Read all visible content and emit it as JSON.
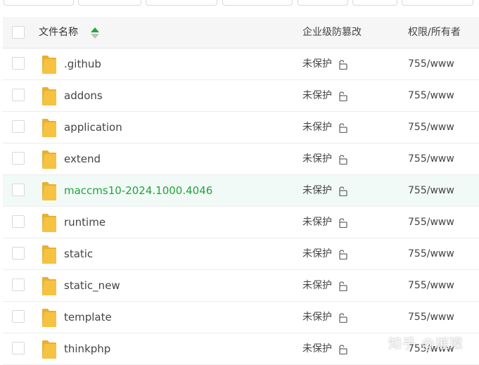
{
  "table": {
    "headers": {
      "name": "文件名称",
      "protection": "企业级防篡改",
      "permission": "权限/所有者"
    },
    "rows": [
      {
        "name": ".github",
        "protection": "未保护",
        "permission": "755/www"
      },
      {
        "name": "addons",
        "protection": "未保护",
        "permission": "755/www"
      },
      {
        "name": "application",
        "protection": "未保护",
        "permission": "755/www"
      },
      {
        "name": "extend",
        "protection": "未保护",
        "permission": "755/www"
      },
      {
        "name": "maccms10-2024.1000.4046",
        "protection": "未保护",
        "permission": "755/www"
      },
      {
        "name": "runtime",
        "protection": "未保护",
        "permission": "755/www"
      },
      {
        "name": "static",
        "protection": "未保护",
        "permission": "755/www"
      },
      {
        "name": "static_new",
        "protection": "未保护",
        "permission": "755/www"
      },
      {
        "name": "template",
        "protection": "未保护",
        "permission": "755/www"
      },
      {
        "name": "thinkphp",
        "protection": "未保护",
        "permission": "755/www"
      }
    ],
    "highlighted_row": 4
  },
  "watermark": "知乎 @璀璨",
  "colors": {
    "accent_green": "#20a53a",
    "folder_yellow": "#f5c242",
    "highlight_bg": "#f1faf6"
  },
  "icons": {
    "folder": "folder-icon",
    "lock": "unlock-icon",
    "sort": "sort-icon"
  }
}
